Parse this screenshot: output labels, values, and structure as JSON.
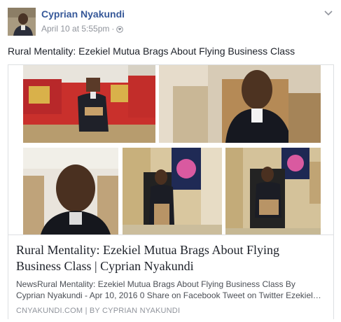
{
  "post": {
    "author": "Cyprian Nyakundi",
    "date": "April 10 at 5:55pm",
    "separator": "·",
    "text": "Rural Mentality: Ezekiel Mutua Brags About Flying Business Class",
    "privacy_icon": "globe-icon",
    "menu_icon": "chevron-down-icon"
  },
  "link_card": {
    "title": "Rural Mentality: Ezekiel Mutua Brags About Flying Business Class | Cyprian Nyakundi",
    "description": "NewsRural Mentality: Ezekiel Mutua Brags About Flying Business Class By Cyprian Nyakundi - Apr 10, 2016 0 Share on Facebook Tweet on Twitter Ezekiel…",
    "domain": "CNYAKUNDI.COM",
    "divider": "|",
    "byline": "BY CYPRIAN NYAKUNDI"
  },
  "colors": {
    "author_link": "#365899",
    "meta_gray": "#90949c",
    "card_border": "#dddfe2",
    "sofa_red": "#c9302c"
  }
}
